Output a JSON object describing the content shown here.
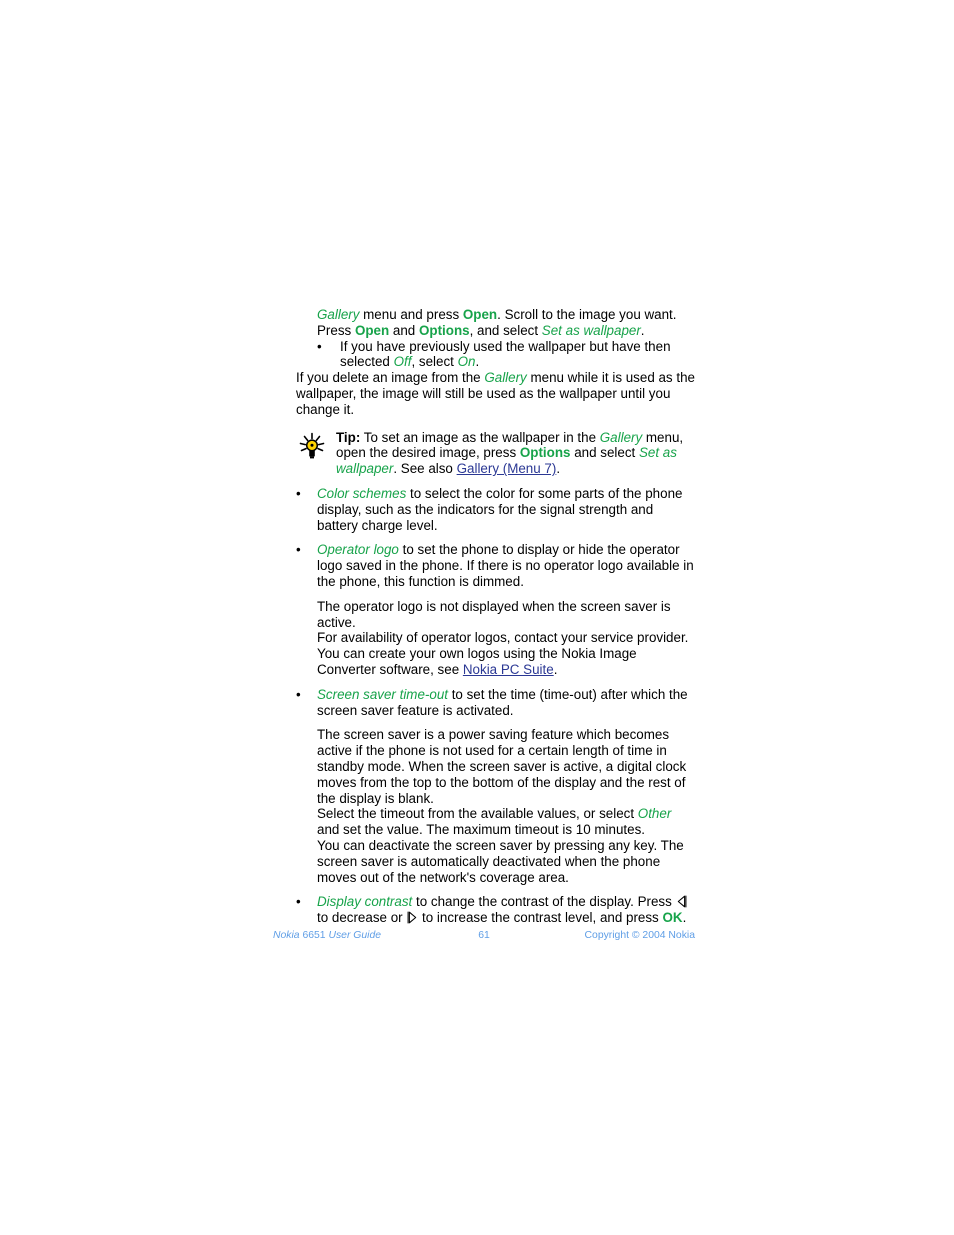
{
  "document": {
    "title": "Nokia 6651 User Guide",
    "page_number": "61",
    "colors": {
      "green": "#17a34a",
      "link_blue": "#2b3894",
      "footer_blue": "#5f9ee6",
      "body_black": "#000000",
      "bulb_yellow": "#ffd400"
    }
  },
  "content": {
    "p1": {
      "t1": "Gallery",
      "t2": " menu and press ",
      "t3": "Open",
      "t4": ". Scroll to the image you want. Press ",
      "t5": "Open",
      "t6": " and ",
      "t7": "Options",
      "t8": ", and select ",
      "t9": "Set as wallpaper",
      "t10": "."
    },
    "bullet_nested_1": {
      "mark": "•",
      "t1": "If you have previously used the wallpaper but have then selected ",
      "t2": "Off",
      "t3": ", select ",
      "t4": "On",
      "t5": "."
    },
    "p2": {
      "t1": "If you delete an image from the ",
      "t2": "Gallery",
      "t3": " menu while it is used as the wallpaper, the image will still be used as the wallpaper until you change it."
    },
    "tip": {
      "icon": "lightbulb-icon",
      "label": "Tip:",
      "t1": " To set an image as the wallpaper in the ",
      "t2": "Gallery",
      "t3": " menu, open the desired image, press ",
      "t4": "Options",
      "t5": " and select ",
      "t6": "Set as wallpaper",
      "t7": ". See also ",
      "link": "Gallery (Menu 7)",
      "t8": "."
    },
    "bullet_color_schemes": {
      "mark": "•",
      "t1": "Color schemes",
      "t2": " to select the color for some parts of the phone display, such as the indicators for the signal strength and battery charge level."
    },
    "bullet_operator_logo": {
      "mark": "•",
      "t1": "Operator logo",
      "t2": " to set the phone to display or hide the operator logo saved in the phone. If there is no operator logo available in the phone, this function is dimmed."
    },
    "p3": "The operator logo is not displayed when the screen saver is active.",
    "p4": {
      "t1": "For availability of operator logos, contact your service provider. You can create your own logos using the Nokia Image Converter software, see ",
      "link": "Nokia PC Suite",
      "t2": "."
    },
    "bullet_screen_saver": {
      "mark": "•",
      "t1": "Screen saver time-out",
      "t2": " to set the time (time-out) after which the screen saver feature is activated."
    },
    "p5": "The screen saver is a power saving feature which becomes active if the phone is not used for a certain length of time in standby mode. When the screen saver is active, a digital clock moves from the top to the bottom of the display and the rest of the display is blank.",
    "p6": {
      "t1": "Select the timeout from the available values, or select ",
      "t2": "Other",
      "t3": " and set the value. The maximum timeout is 10 minutes."
    },
    "p7": "You can deactivate the screen saver by pressing any key. The screen saver is automatically deactivated when the phone moves out of the network's coverage area.",
    "bullet_display_contrast": {
      "mark": "•",
      "t1": "Display contrast",
      "t2": " to change the contrast of the display. Press ",
      "icon_left": "left-arrow-key-icon",
      "t3": " to decrease or ",
      "icon_right": "right-arrow-key-icon",
      "t4": " to increase the contrast level, and press ",
      "t5": "OK",
      "t6": "."
    }
  },
  "footer": {
    "left_brand": "Nokia",
    "left_model": " 6651 ",
    "left_guide": "User Guide",
    "center": "61",
    "right": "Copyright © 2004 Nokia"
  }
}
